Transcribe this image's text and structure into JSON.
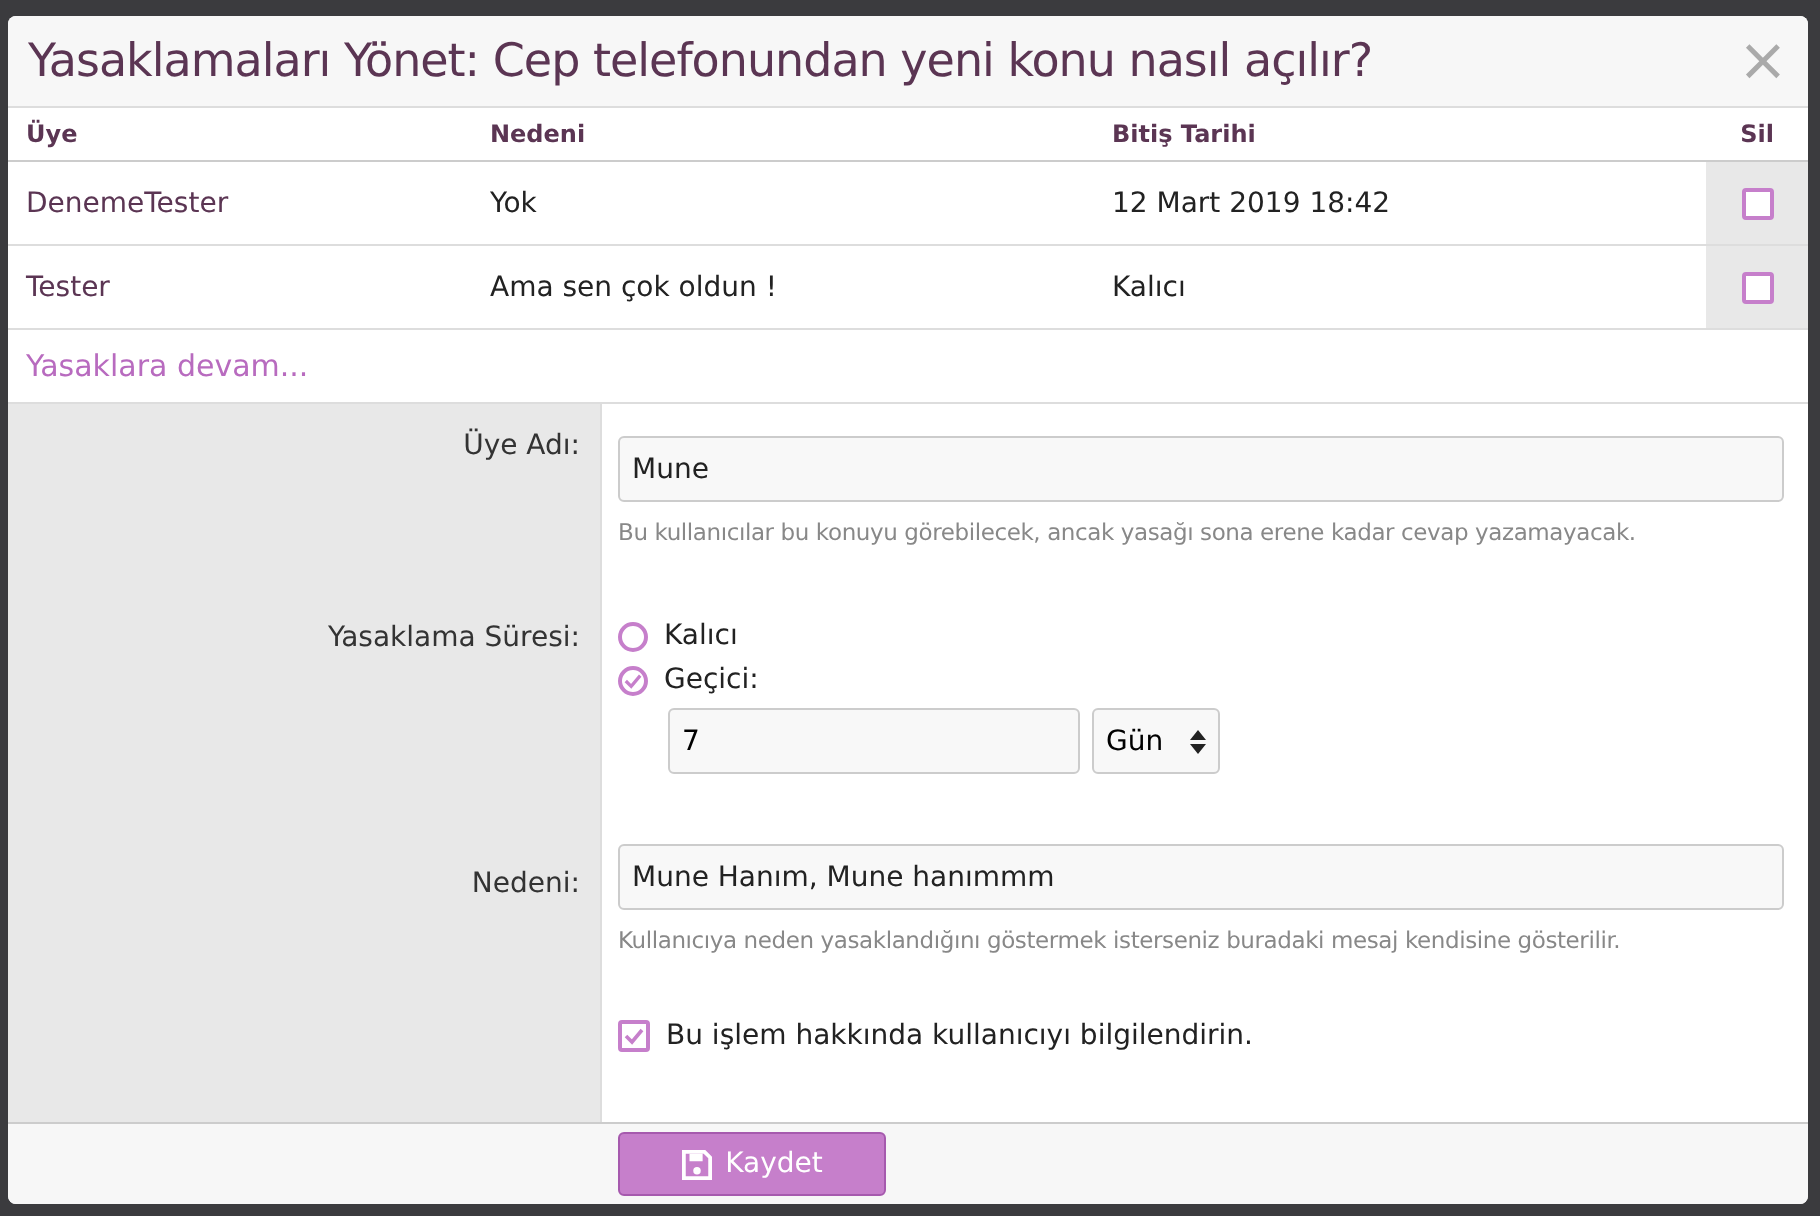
{
  "dialog": {
    "title": "Yasaklamaları Yönet: Cep telefonundan yeni konu nasıl açılır?",
    "close": "×"
  },
  "table": {
    "columns": [
      "Üye",
      "Nedeni",
      "Bitiş Tarihi",
      "Sil"
    ],
    "rows": [
      {
        "cells": [
          "DenemeTester",
          "Yok",
          "12 Mart 2019 18:42"
        ],
        "checked": false
      },
      {
        "cells": [
          "Tester",
          "Ama sen çok oldun !",
          "Kalıcı"
        ],
        "checked": false
      }
    ]
  },
  "more_link": "Yasaklara devam...",
  "form": {
    "username": {
      "label": "Üye Adı:",
      "value": "Mune",
      "hint": "Bu kullanıcılar bu konuyu görebilecek, ancak yasağı sona erene kadar cevap yazamayacak."
    },
    "duration": {
      "label": "Yasaklama Süresi:",
      "options": [
        {
          "label": "Kalıcı",
          "selected": false
        },
        {
          "label": "Geçici:",
          "selected": true
        }
      ],
      "amount": "7",
      "unit": "Gün"
    },
    "reason": {
      "label": "Nedeni:",
      "value": "Mune Hanım, Mune hanımmm",
      "hint": "Kullanıcıya neden yasaklandığını göstermek isterseniz buradaki mesaj kendisine gösterilir."
    },
    "notify": {
      "label": "Bu işlem hakkında kullanıcıyı bilgilendirin.",
      "checked": true
    }
  },
  "save_button": "Kaydet"
}
